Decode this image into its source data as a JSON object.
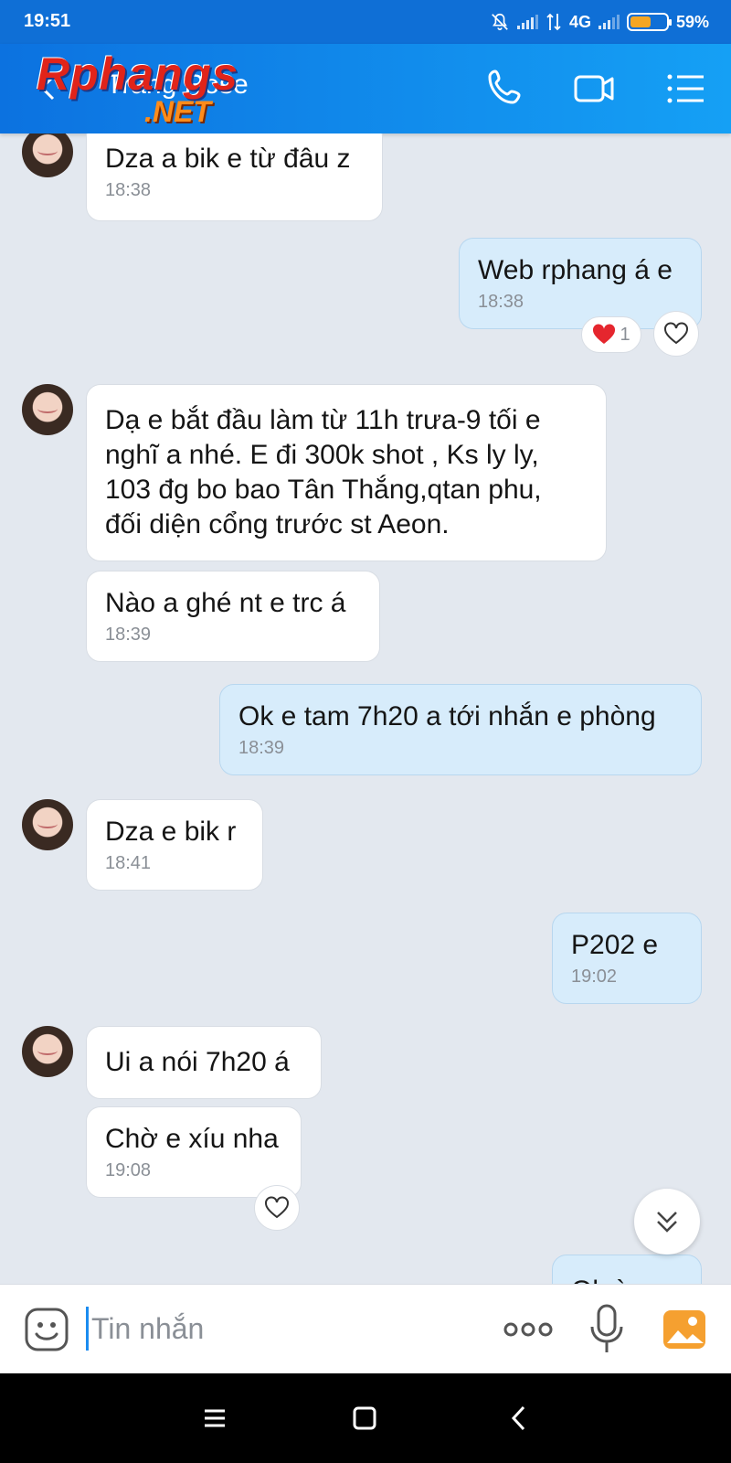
{
  "status_bar": {
    "time": "19:51",
    "network": "4G",
    "battery": "59%",
    "battery_level": 0.59
  },
  "header": {
    "contact_name": "Trang Rose",
    "watermark_top": "Rphangs",
    "watermark_bottom": ".NET",
    "icons": [
      "back-arrow-icon",
      "phone-icon",
      "video-call-icon",
      "menu-list-icon"
    ],
    "accent": "#0f6fd6"
  },
  "messages": [
    {
      "dir": "in",
      "text": "Dza a bik e từ đâu z",
      "time": "18:38"
    },
    {
      "dir": "out",
      "text": "Web rphang á e",
      "time": "18:38",
      "reaction_count": "1"
    },
    {
      "dir": "in",
      "text": "Dạ e  bắt đầu làm từ 11h trưa-9 tối e\nnghĩ a nhé. E đi 300k shot , Ks ly ly,\n103 đg bo bao Tân Thắng,qtan phu,\nđối diện cổng trước st Aeon."
    },
    {
      "dir": "in",
      "text": "Nào a ghé nt e trc á",
      "time": "18:39"
    },
    {
      "dir": "out",
      "text": "Ok e tam 7h20 a tới nhắn e phòng",
      "time": "18:39"
    },
    {
      "dir": "in",
      "text": "Dza e bik r",
      "time": "18:41"
    },
    {
      "dir": "out",
      "text": "P202 e",
      "time": "19:02"
    },
    {
      "dir": "in",
      "text": "Ui a nói 7h20 á"
    },
    {
      "dir": "in",
      "text": "Chờ e xíu nha",
      "time": "19:08"
    },
    {
      "dir": "out",
      "text": "Ok à"
    }
  ],
  "input": {
    "placeholder": "Tin nhắn"
  },
  "colors": {
    "outgoing_bubble": "#d7ecfb",
    "incoming_bubble": "#ffffff",
    "background": "#e3e8ef"
  }
}
